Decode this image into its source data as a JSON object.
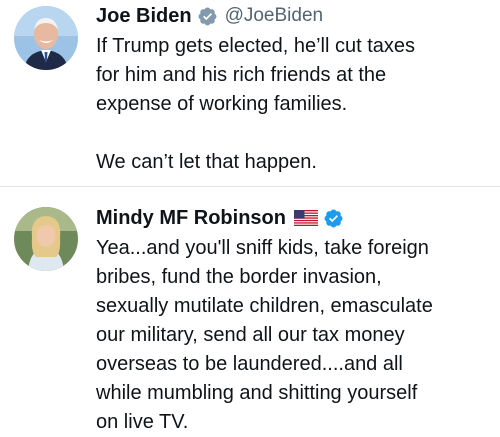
{
  "tweets": [
    {
      "name": "Joe Biden",
      "handle": "@JoeBiden",
      "verified_icon": "verified-badge-gray",
      "lines": [
        "If Trump gets elected, he’ll cut taxes",
        "for him and his rich friends at the",
        "expense of working families."
      ],
      "second_paragraph": "We can’t let that happen."
    },
    {
      "name": "Mindy MF Robinson",
      "flag_icon": "us-flag-icon",
      "verified_icon": "verified-badge-blue",
      "lines": [
        "Yea...and you'll sniff kids, take foreign",
        "bribes, fund the border invasion,",
        "sexually mutilate children, emasculate",
        "our military, send all our tax money",
        "overseas to be laundered....and all",
        "while mumbling and shitting yourself",
        "on live TV."
      ]
    }
  ],
  "colors": {
    "text": "#0f1419",
    "secondary": "#536471",
    "verified_blue": "#1d9bf0",
    "verified_gray": "#829aab",
    "divider": "#e6e6e6"
  }
}
